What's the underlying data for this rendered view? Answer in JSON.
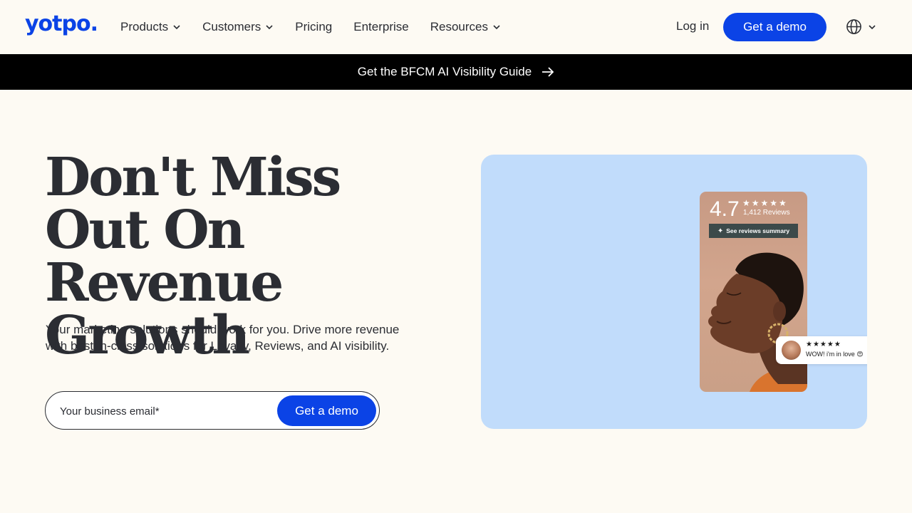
{
  "header": {
    "logo": "yotpo.",
    "nav": [
      {
        "label": "Products",
        "has_dropdown": true
      },
      {
        "label": "Customers",
        "has_dropdown": true
      },
      {
        "label": "Pricing",
        "has_dropdown": false
      },
      {
        "label": "Enterprise",
        "has_dropdown": false
      },
      {
        "label": "Resources",
        "has_dropdown": true
      }
    ],
    "login_label": "Log in",
    "demo_label": "Get a demo",
    "language_icon": "globe-icon"
  },
  "banner": {
    "text": "Get the BFCM AI Visibility Guide",
    "icon": "arrow-right-icon"
  },
  "hero": {
    "headline": "Don't Miss Out On Revenue Growth",
    "subtext": "Your marketing solutions should work for you. Drive more revenue with best-in-class solutions for Loyalty, Reviews, and AI visibility.",
    "email_placeholder": "Your business email*",
    "demo_label": "Get a demo"
  },
  "visual": {
    "rating": "4.7",
    "stars": "★★★★★",
    "reviews_count": "1,412 Reviews",
    "summary_button": "See reviews summary",
    "review_chip": {
      "stars": "★★★★★",
      "text": "WOW! i'm in love 😍"
    }
  },
  "colors": {
    "brand_blue": "#0b43e6",
    "page_bg": "#fdfaf3",
    "visual_bg": "#c1dcfb",
    "banner_bg": "#000000"
  }
}
